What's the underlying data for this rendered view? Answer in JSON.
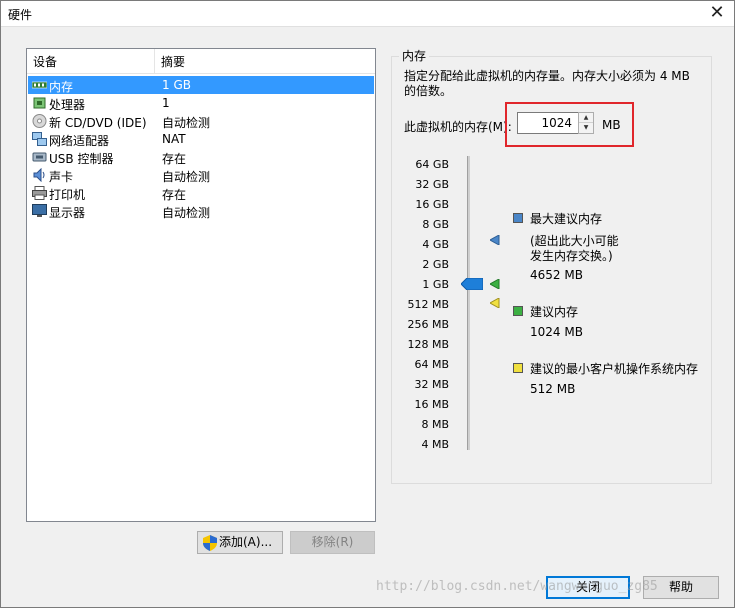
{
  "window": {
    "title": "硬件"
  },
  "device_list": {
    "headers": {
      "device": "设备",
      "summary": "摘要"
    },
    "rows": [
      {
        "name": "内存",
        "summary": "1 GB",
        "icon": "memory-icon",
        "selected": true
      },
      {
        "name": "处理器",
        "summary": "1",
        "icon": "processor-icon",
        "selected": false
      },
      {
        "name": "新 CD/DVD (IDE)",
        "summary": "自动检测",
        "icon": "cd-dvd-icon",
        "selected": false
      },
      {
        "name": "网络适配器",
        "summary": "NAT",
        "icon": "network-adapter-icon",
        "selected": false
      },
      {
        "name": "USB 控制器",
        "summary": "存在",
        "icon": "usb-icon",
        "selected": false
      },
      {
        "name": "声卡",
        "summary": "自动检测",
        "icon": "sound-card-icon",
        "selected": false
      },
      {
        "name": "打印机",
        "summary": "存在",
        "icon": "printer-icon",
        "selected": false
      },
      {
        "name": "显示器",
        "summary": "自动检测",
        "icon": "display-icon",
        "selected": false
      }
    ]
  },
  "buttons": {
    "add": "添加(A)...",
    "remove": "移除(R)",
    "close": "关闭",
    "help": "帮助"
  },
  "memory": {
    "group_title": "内存",
    "description": "指定分配给此虚拟机的内存量。内存大小必须为 4 MB 的倍数。",
    "label": "此虚拟机的内存(M):",
    "value": "1024",
    "unit": "MB",
    "scale_ticks": [
      "64 GB",
      "32 GB",
      "16 GB",
      "8 GB",
      "4 GB",
      "2 GB",
      "1 GB",
      "512 MB",
      "256 MB",
      "128 MB",
      "64 MB",
      "32 MB",
      "16 MB",
      "8 MB",
      "4 MB"
    ],
    "legend": {
      "max": {
        "title": "最大建议内存",
        "note": "(超出此大小可能发生内存交换。)",
        "value": "4652 MB",
        "color": "#4a86c8"
      },
      "recommended": {
        "title": "建议内存",
        "value": "1024 MB",
        "color": "#3cb043"
      },
      "minimum": {
        "title": "建议的最小客户机操作系统内存",
        "value": "512 MB",
        "color": "#f0e040"
      }
    }
  },
  "watermark": "http://blog.csdn.net/wangwenguo_zg85"
}
